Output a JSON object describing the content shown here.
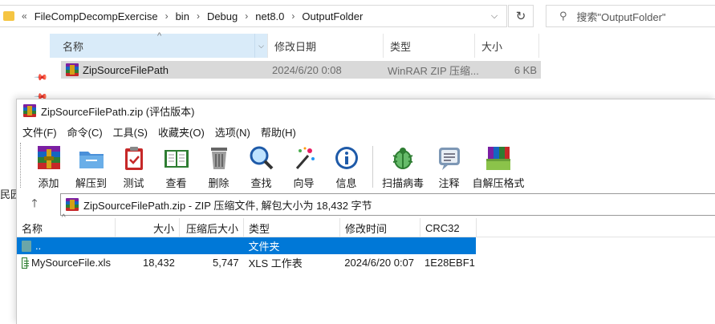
{
  "explorer": {
    "breadcrumb": [
      "FileCompDecompExercise",
      "bin",
      "Debug",
      "net8.0",
      "OutputFolder"
    ],
    "prefix": "«",
    "search_placeholder": "搜索\"OutputFolder\"",
    "columns": {
      "name": "名称",
      "date": "修改日期",
      "type": "类型",
      "size": "大小"
    },
    "row": {
      "name": "ZipSourceFilePath",
      "date": "2024/6/20 0:08",
      "type": "WinRAR ZIP 压缩...",
      "size": "6 KB"
    },
    "left_edge_text": "民园地"
  },
  "winrar": {
    "title": "ZipSourceFilePath.zip (评估版本)",
    "menu": [
      "文件(F)",
      "命令(C)",
      "工具(S)",
      "收藏夹(O)",
      "选项(N)",
      "帮助(H)"
    ],
    "toolbar": {
      "add": "添加",
      "extract": "解压到",
      "test": "测试",
      "view": "查看",
      "delete": "删除",
      "find": "查找",
      "wizard": "向导",
      "info": "信息",
      "virus": "扫描病毒",
      "comment": "注释",
      "sfx": "自解压格式"
    },
    "path_text": "ZipSourceFilePath.zip - ZIP 压缩文件, 解包大小为 18,432 字节",
    "columns": {
      "name": "名称",
      "size": "大小",
      "packed": "压缩后大小",
      "type": "类型",
      "modified": "修改时间",
      "crc": "CRC32"
    },
    "rows": [
      {
        "name": "..",
        "size": "",
        "packed": "",
        "type": "文件夹",
        "modified": "",
        "crc": ""
      },
      {
        "name": "MySourceFile.xls",
        "size": "18,432",
        "packed": "5,747",
        "type": "XLS 工作表",
        "modified": "2024/6/20 0:07",
        "crc": "1E28EBF1"
      }
    ],
    "selection_color": "#0078d7"
  }
}
